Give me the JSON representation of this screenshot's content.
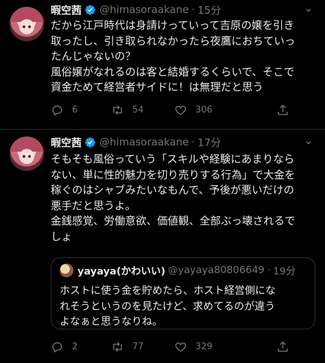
{
  "tweets": [
    {
      "name": "暇空茜",
      "handle": "@himasoraakane",
      "dot": "·",
      "time": "15分",
      "more": "⌄",
      "text": "だから江戸時代は身請けっていって吉原の嬢を引き\n取ったし、引き取られなかったら夜鷹におちていっ\nたんじゃないの？\n風俗嬢がなれるのは客と結婚するくらいで、そこで\n資金ためて経営者サイドに！は無理だと思う",
      "replies": "6",
      "retweets": "54",
      "likes": "306"
    },
    {
      "name": "暇空茜",
      "handle": "@himasoraakane",
      "dot": "·",
      "time": "17分",
      "more": "⌄",
      "text": "そもそも風俗っていう「スキルや経験にあまりなら\nない、単に性的魅力を切り売りする行為」で大金を\n稼ぐのはシャブみたいなもんで、予後が悪いだけの\n悪手だと思うよ。\n金銭感覚、労働意欲、価値観、全部ぶっ壊されるで\nしょ",
      "replies": "2",
      "retweets": "77",
      "likes": "329",
      "quote": {
        "name": "yayaya(かわいい)",
        "handle": "@yayaya80806649",
        "dot": "·",
        "time": "19分",
        "text": "ホストに使う金を貯めたら、ホスト経営側にな\nれそうというのを見たけど、求めてるのが違う\nよなぁと思うなりね。"
      }
    }
  ],
  "colors": {
    "background": "#000000",
    "text": "#e7e9ea",
    "muted": "#71767b",
    "verified": "#1d9bf0",
    "border": "#2f3336"
  },
  "icons": [
    "verified-badge-icon",
    "more-icon",
    "reply-icon",
    "retweet-icon",
    "like-icon",
    "share-icon"
  ]
}
